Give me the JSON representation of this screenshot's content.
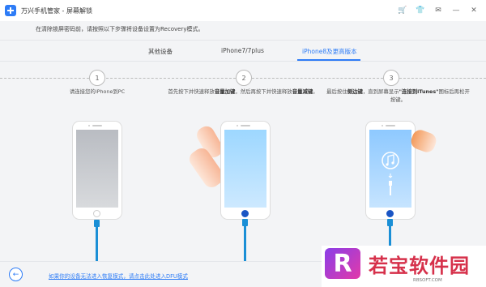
{
  "app": {
    "title": "万兴手机管家 - 屏幕解锁"
  },
  "window_controls": {
    "cart": "🛒",
    "tshirt": "👕",
    "mail": "✉",
    "minimize": "—",
    "close": "✕"
  },
  "notice": "在清除锁屏密码前，请按照以下步骤将设备设置为Recovery模式。",
  "tabs": [
    {
      "label": "其他设备",
      "active": false
    },
    {
      "label": "iPhone7/7plus",
      "active": false
    },
    {
      "label": "iPhone8及更高版本",
      "active": true
    }
  ],
  "steps": [
    {
      "number": "1",
      "text": "请连接您的iPhone到PC"
    },
    {
      "number": "2",
      "text_pre": "首先按下并快速释放",
      "bold1": "音量加键",
      "text_mid": "，然后再按下并快速释放",
      "bold2": "音量减键",
      "text_post": "。"
    },
    {
      "number": "3",
      "text_pre": "最后按住",
      "bold1": "侧边键",
      "text_mid": "，直到屏幕显示",
      "bold2": "\"连接到iTunes\"",
      "text_post": "图标后再松开按键。"
    }
  ],
  "footer": {
    "back_icon": "←",
    "dfu_link": "如果你的设备无法进入恢复模式，请点击此处进入DFU模式"
  },
  "watermark": {
    "logo_letter": "R",
    "text": "若宝软件园",
    "url": "RBSOFT.COM"
  },
  "colors": {
    "accent": "#2e7cf6",
    "cable": "#1a8fd6",
    "home_button": "#1a55c4"
  }
}
